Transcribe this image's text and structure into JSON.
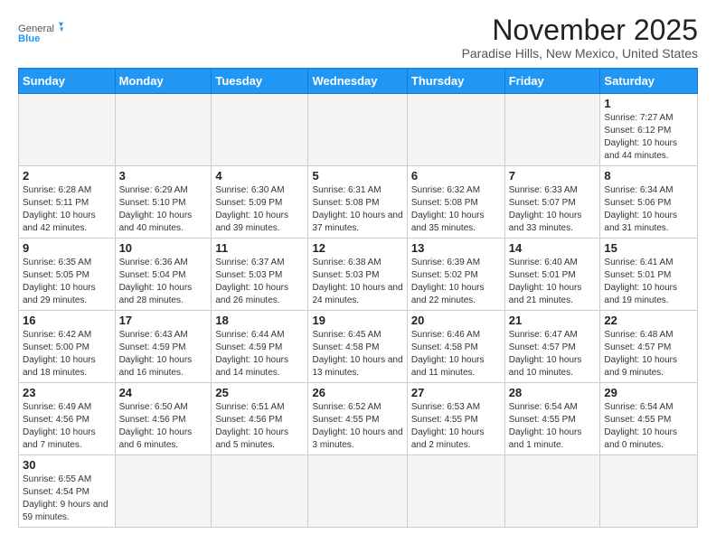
{
  "logo": {
    "line1": "General",
    "line2": "Blue"
  },
  "title": "November 2025",
  "location": "Paradise Hills, New Mexico, United States",
  "weekdays": [
    "Sunday",
    "Monday",
    "Tuesday",
    "Wednesday",
    "Thursday",
    "Friday",
    "Saturday"
  ],
  "weeks": [
    [
      {
        "day": "",
        "info": ""
      },
      {
        "day": "",
        "info": ""
      },
      {
        "day": "",
        "info": ""
      },
      {
        "day": "",
        "info": ""
      },
      {
        "day": "",
        "info": ""
      },
      {
        "day": "",
        "info": ""
      },
      {
        "day": "1",
        "info": "Sunrise: 7:27 AM\nSunset: 6:12 PM\nDaylight: 10 hours and 44 minutes."
      }
    ],
    [
      {
        "day": "2",
        "info": "Sunrise: 6:28 AM\nSunset: 5:11 PM\nDaylight: 10 hours and 42 minutes."
      },
      {
        "day": "3",
        "info": "Sunrise: 6:29 AM\nSunset: 5:10 PM\nDaylight: 10 hours and 40 minutes."
      },
      {
        "day": "4",
        "info": "Sunrise: 6:30 AM\nSunset: 5:09 PM\nDaylight: 10 hours and 39 minutes."
      },
      {
        "day": "5",
        "info": "Sunrise: 6:31 AM\nSunset: 5:08 PM\nDaylight: 10 hours and 37 minutes."
      },
      {
        "day": "6",
        "info": "Sunrise: 6:32 AM\nSunset: 5:08 PM\nDaylight: 10 hours and 35 minutes."
      },
      {
        "day": "7",
        "info": "Sunrise: 6:33 AM\nSunset: 5:07 PM\nDaylight: 10 hours and 33 minutes."
      },
      {
        "day": "8",
        "info": "Sunrise: 6:34 AM\nSunset: 5:06 PM\nDaylight: 10 hours and 31 minutes."
      }
    ],
    [
      {
        "day": "9",
        "info": "Sunrise: 6:35 AM\nSunset: 5:05 PM\nDaylight: 10 hours and 29 minutes."
      },
      {
        "day": "10",
        "info": "Sunrise: 6:36 AM\nSunset: 5:04 PM\nDaylight: 10 hours and 28 minutes."
      },
      {
        "day": "11",
        "info": "Sunrise: 6:37 AM\nSunset: 5:03 PM\nDaylight: 10 hours and 26 minutes."
      },
      {
        "day": "12",
        "info": "Sunrise: 6:38 AM\nSunset: 5:03 PM\nDaylight: 10 hours and 24 minutes."
      },
      {
        "day": "13",
        "info": "Sunrise: 6:39 AM\nSunset: 5:02 PM\nDaylight: 10 hours and 22 minutes."
      },
      {
        "day": "14",
        "info": "Sunrise: 6:40 AM\nSunset: 5:01 PM\nDaylight: 10 hours and 21 minutes."
      },
      {
        "day": "15",
        "info": "Sunrise: 6:41 AM\nSunset: 5:01 PM\nDaylight: 10 hours and 19 minutes."
      }
    ],
    [
      {
        "day": "16",
        "info": "Sunrise: 6:42 AM\nSunset: 5:00 PM\nDaylight: 10 hours and 18 minutes."
      },
      {
        "day": "17",
        "info": "Sunrise: 6:43 AM\nSunset: 4:59 PM\nDaylight: 10 hours and 16 minutes."
      },
      {
        "day": "18",
        "info": "Sunrise: 6:44 AM\nSunset: 4:59 PM\nDaylight: 10 hours and 14 minutes."
      },
      {
        "day": "19",
        "info": "Sunrise: 6:45 AM\nSunset: 4:58 PM\nDaylight: 10 hours and 13 minutes."
      },
      {
        "day": "20",
        "info": "Sunrise: 6:46 AM\nSunset: 4:58 PM\nDaylight: 10 hours and 11 minutes."
      },
      {
        "day": "21",
        "info": "Sunrise: 6:47 AM\nSunset: 4:57 PM\nDaylight: 10 hours and 10 minutes."
      },
      {
        "day": "22",
        "info": "Sunrise: 6:48 AM\nSunset: 4:57 PM\nDaylight: 10 hours and 9 minutes."
      }
    ],
    [
      {
        "day": "23",
        "info": "Sunrise: 6:49 AM\nSunset: 4:56 PM\nDaylight: 10 hours and 7 minutes."
      },
      {
        "day": "24",
        "info": "Sunrise: 6:50 AM\nSunset: 4:56 PM\nDaylight: 10 hours and 6 minutes."
      },
      {
        "day": "25",
        "info": "Sunrise: 6:51 AM\nSunset: 4:56 PM\nDaylight: 10 hours and 5 minutes."
      },
      {
        "day": "26",
        "info": "Sunrise: 6:52 AM\nSunset: 4:55 PM\nDaylight: 10 hours and 3 minutes."
      },
      {
        "day": "27",
        "info": "Sunrise: 6:53 AM\nSunset: 4:55 PM\nDaylight: 10 hours and 2 minutes."
      },
      {
        "day": "28",
        "info": "Sunrise: 6:54 AM\nSunset: 4:55 PM\nDaylight: 10 hours and 1 minute."
      },
      {
        "day": "29",
        "info": "Sunrise: 6:54 AM\nSunset: 4:55 PM\nDaylight: 10 hours and 0 minutes."
      }
    ],
    [
      {
        "day": "30",
        "info": "Sunrise: 6:55 AM\nSunset: 4:54 PM\nDaylight: 9 hours and 59 minutes."
      },
      {
        "day": "",
        "info": ""
      },
      {
        "day": "",
        "info": ""
      },
      {
        "day": "",
        "info": ""
      },
      {
        "day": "",
        "info": ""
      },
      {
        "day": "",
        "info": ""
      },
      {
        "day": "",
        "info": ""
      }
    ]
  ]
}
